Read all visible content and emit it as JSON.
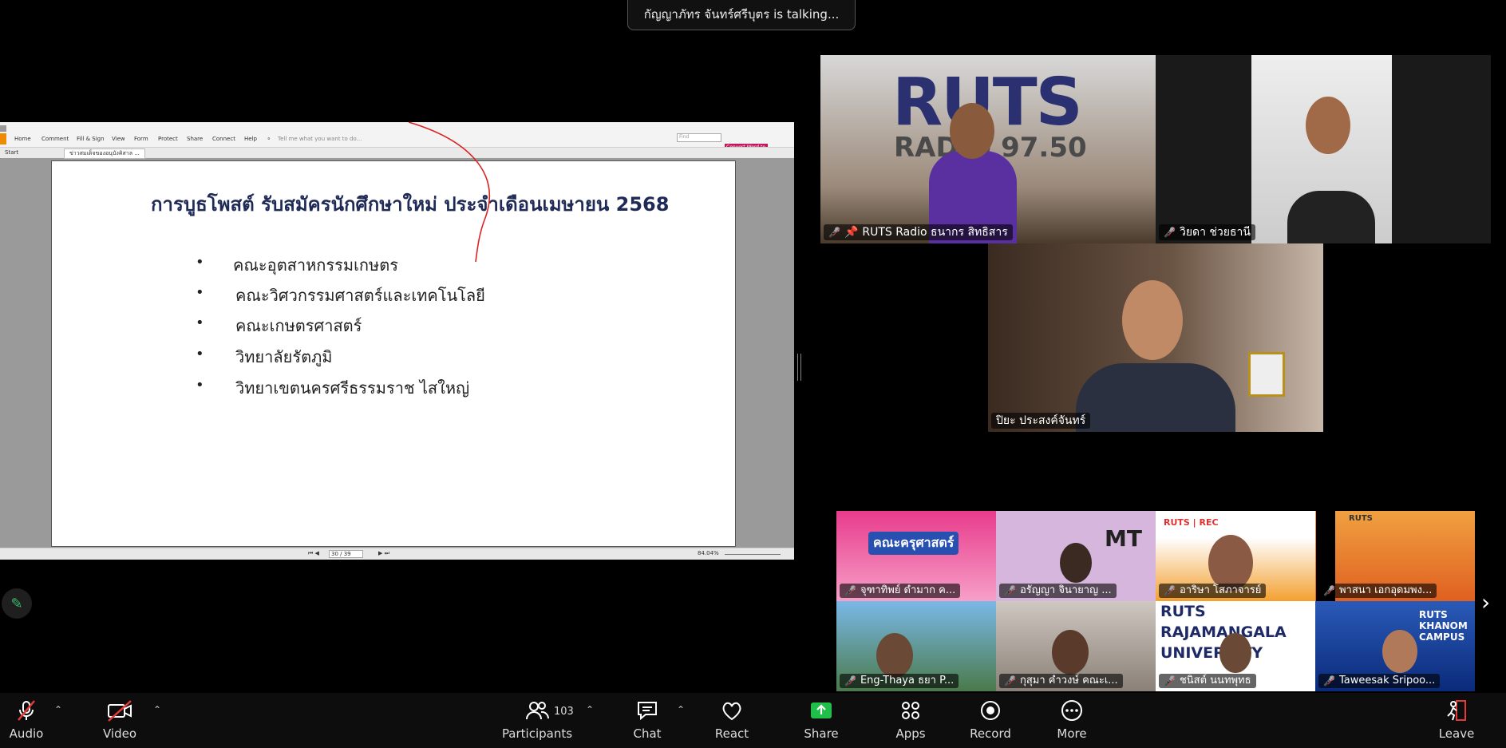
{
  "talking_banner": "กัญญาภัทร จันทร์ศรีบุตร is talking...",
  "shared_screen": {
    "menu_items": [
      "Home",
      "Comment",
      "Fill & Sign",
      "View",
      "Form",
      "Protect",
      "Share",
      "Connect",
      "Help"
    ],
    "tell_me": "Tell me what you want to do...",
    "find_placeholder": "Find",
    "start_tab": "Start",
    "doc_tab": "ข่าวสมเด็จของอนุบังคิสาล ...",
    "convert_button": "Convert Word to PDF",
    "page_indicator": "30 / 39",
    "zoom": "84.04%",
    "slide": {
      "title": "การบูธโพสต์ รับสมัครนักศึกษาใหม่ ประจำเดือนเมษายน 2568",
      "bullets": [
        "คณะอุตสาหกรรมเกษตร",
        "คณะวิศวกรรมศาสตร์และเทคโนโลยี",
        "คณะเกษตรศาสตร์",
        "วิทยาลัยรัตภูมิ",
        "วิทยาเขตนครศรีธรรมราช ไสใหญ่"
      ]
    }
  },
  "main_tiles": [
    {
      "name": "RUTS Radio ธนากร สิทธิสาร",
      "pinned": true,
      "bg_text": "RUTS",
      "bg_sub": "RADIO 97.50"
    },
    {
      "name": "วิยดา ช่วยธานี"
    },
    {
      "name": "ปิยะ ประสงค์จันทร์"
    }
  ],
  "gallery": [
    {
      "name": "จุฑาทิพย์ ดำมาก ค...",
      "bg_text": "คณะครุศาสตร์"
    },
    {
      "name": "อรัญญา จินายาญ ...",
      "bg_text": "MT"
    },
    {
      "name": "อาริษา โสภาจารย์",
      "bg_text": "RUTS | REC"
    },
    {
      "name": "พาสนา เอกอุดมพง...",
      "bg_text": "RUTS"
    },
    {
      "name": "Eng-Thaya ธยา  P..."
    },
    {
      "name": "กุสุมา คำวงษ์ คณะเ..."
    },
    {
      "name": "ชนิสต์ นนทพุทธ",
      "bg_text": "RUTS RAJAMANGALA UNIVERSITY"
    },
    {
      "name": "Taweesak Sripoo...",
      "bg_text": "RUTS KHANOM CAMPUS"
    }
  ],
  "toolbar": {
    "audio": "Audio",
    "video": "Video",
    "participants": "Participants",
    "participant_count": "103",
    "chat": "Chat",
    "react": "React",
    "share": "Share",
    "apps": "Apps",
    "record": "Record",
    "more": "More",
    "leave": "Leave"
  },
  "colors": {
    "share_green": "#1fbf4a",
    "mute_red": "#e53935",
    "leave_red": "#e53935"
  }
}
